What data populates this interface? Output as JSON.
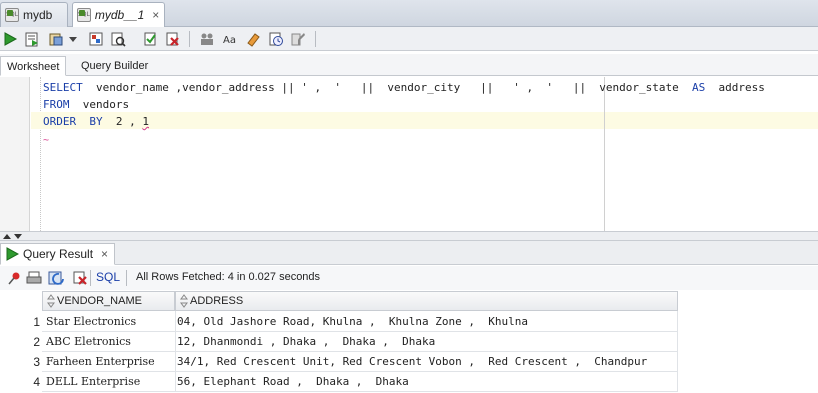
{
  "doc_tabs": [
    {
      "label": "mydb",
      "italic": false,
      "active": false,
      "close": ""
    },
    {
      "label": "mydb__1",
      "italic": true,
      "active": true,
      "close": "×"
    }
  ],
  "editor_tabs": {
    "worksheet": "Worksheet",
    "query_builder": "Query Builder"
  },
  "sql": {
    "line1": {
      "kw_select": "SELECT",
      "part1": "  vendor_name ,vendor_address || ' ,  '   ||  vendor_city   ||   ' ,  '   ||  vendor_state  ",
      "kw_as": "AS",
      "part2": "  address"
    },
    "line2": {
      "kw_from": "FROM",
      "part": "  vendors"
    },
    "line3": {
      "kw_order": "ORDER",
      "kw_by": "BY",
      "part": "  2 , ",
      "cursor_char": "1"
    },
    "line4_marker": "~"
  },
  "result": {
    "tab_label": "Query Result",
    "tab_close": "×",
    "sql_label": "SQL",
    "status": "All Rows Fetched: 4 in 0.027 seconds",
    "columns": [
      "VENDOR_NAME",
      "ADDRESS"
    ],
    "rows": [
      {
        "num": "1",
        "vendor_name": "Star Electronics",
        "address": "04, Old Jashore Road, Khulna ,  Khulna Zone ,  Khulna"
      },
      {
        "num": "2",
        "vendor_name": "ABC Eletronics",
        "address": "12, Dhanmondi , Dhaka ,  Dhaka ,  Dhaka"
      },
      {
        "num": "3",
        "vendor_name": "Farheen Enterprise",
        "address": "34/1, Red Crescent Unit, Red Crescent Vobon ,  Red Crescent ,  Chandpur"
      },
      {
        "num": "4",
        "vendor_name": "DELL Enterprise",
        "address": "56, Elephant Road ,  Dhaka ,  Dhaka"
      }
    ]
  },
  "colors": {
    "keyword": "#1a3ea8",
    "accent_green": "#2e9a2e",
    "squiggle": "#d43a8a"
  }
}
